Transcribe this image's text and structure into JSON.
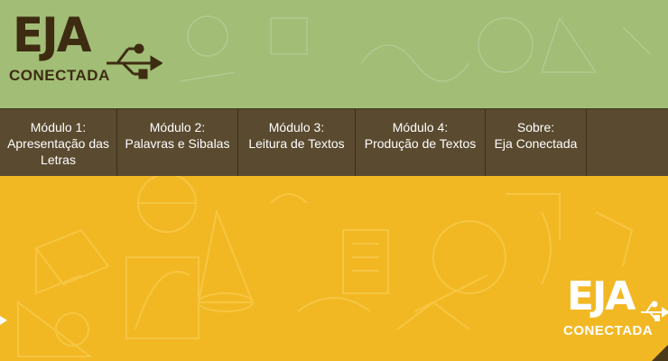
{
  "logo": {
    "eja": "EJA",
    "conectada": "CONECTADA"
  },
  "nav": {
    "items": [
      {
        "label": "Módulo 1:\nApresentação das\nLetras"
      },
      {
        "label": "Módulo 2:\nPalavras e Sibalas"
      },
      {
        "label": "Módulo 3:\nLeitura de Textos"
      },
      {
        "label": "Módulo 4:\nProdução de Textos"
      },
      {
        "label": "Sobre:\nEja Conectada"
      }
    ]
  },
  "hero_logo": {
    "eja": "EJA",
    "conectada": "CONECTADA"
  },
  "colors": {
    "header_bg": "#a2bd76",
    "nav_bg": "#5a4a2f",
    "hero_bg": "#f2b824",
    "logo_dark": "#3d2c12"
  },
  "icons": [
    "usb-icon",
    "slide-arrow-icon"
  ]
}
